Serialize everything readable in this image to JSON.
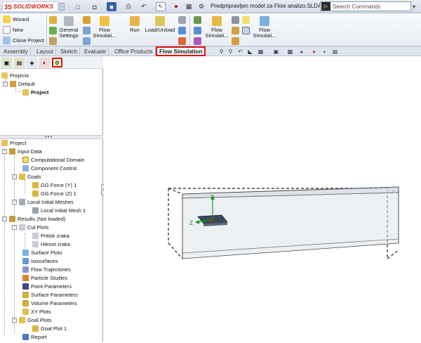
{
  "app": {
    "logo_mark": "3S",
    "logo_text": "SOLIDWORKS",
    "document_title": "Predpripravljen model za Flow analizo.SLDASM",
    "search_placeholder": "Search Commands"
  },
  "ribbon": {
    "wizard": "Wizard",
    "new": "New",
    "clone_project": "Clone Project",
    "general_settings_line1": "General",
    "general_settings_line2": "Settings",
    "flow_simulation_1_line1": "Flow",
    "flow_simulation_1_line2": "Simulati...",
    "run": "Run",
    "load_unload": "Load/Unload",
    "flow_simulation_2_line1": "Flow",
    "flow_simulation_2_line2": "Simulati...",
    "flow_simulation_3_line1": "Flow",
    "flow_simulation_3_line2": "Simulati..."
  },
  "tabs": [
    "Assembly",
    "Layout",
    "Sketch",
    "Evaluate",
    "Office Products",
    "Flow Simulation"
  ],
  "active_tab": "Flow Simulation",
  "top_tree": {
    "projects": "Projects",
    "default": "Default",
    "project": "Project"
  },
  "analysis_tree": {
    "project": "Project",
    "input_data": "Input Data",
    "computational_domain": "Computational Domain",
    "component_control": "Component Control",
    "goals": "Goals",
    "goal_1": "GG Force (Y) 1",
    "goal_2": "GG Force (Z) 1",
    "local_initial_meshes": "Local Initial Meshes",
    "local_initial_mesh_1": "Local Initial Mesh 1",
    "results": "Results (Not loaded)",
    "cut_plots": "Cut Plots",
    "cut_plot_1": "Pritisk zraka",
    "cut_plot_2": "Hitrost zraka",
    "surface_plots": "Surface Plots",
    "isosurfaces": "Isosurfaces",
    "flow_trajectories": "Flow Trajectories",
    "particle_studies": "Particle Studies",
    "point_parameters": "Point Parameters",
    "surface_parameters": "Surface Parameters",
    "volume_parameters": "Volume Parameters",
    "xy_plots": "XY Plots",
    "goal_plots": "Goal Plots",
    "goal_plot_1": "Goal Plot 1",
    "report": "Report"
  },
  "axes": {
    "y": "Y",
    "z": "Z"
  },
  "colors": {
    "highlight_red": "#e01010",
    "axis_y": "#1a9a1a",
    "axis_z": "#1a9a1a",
    "axis_x": "#d02020",
    "model_plate": "#3a4a5a"
  }
}
